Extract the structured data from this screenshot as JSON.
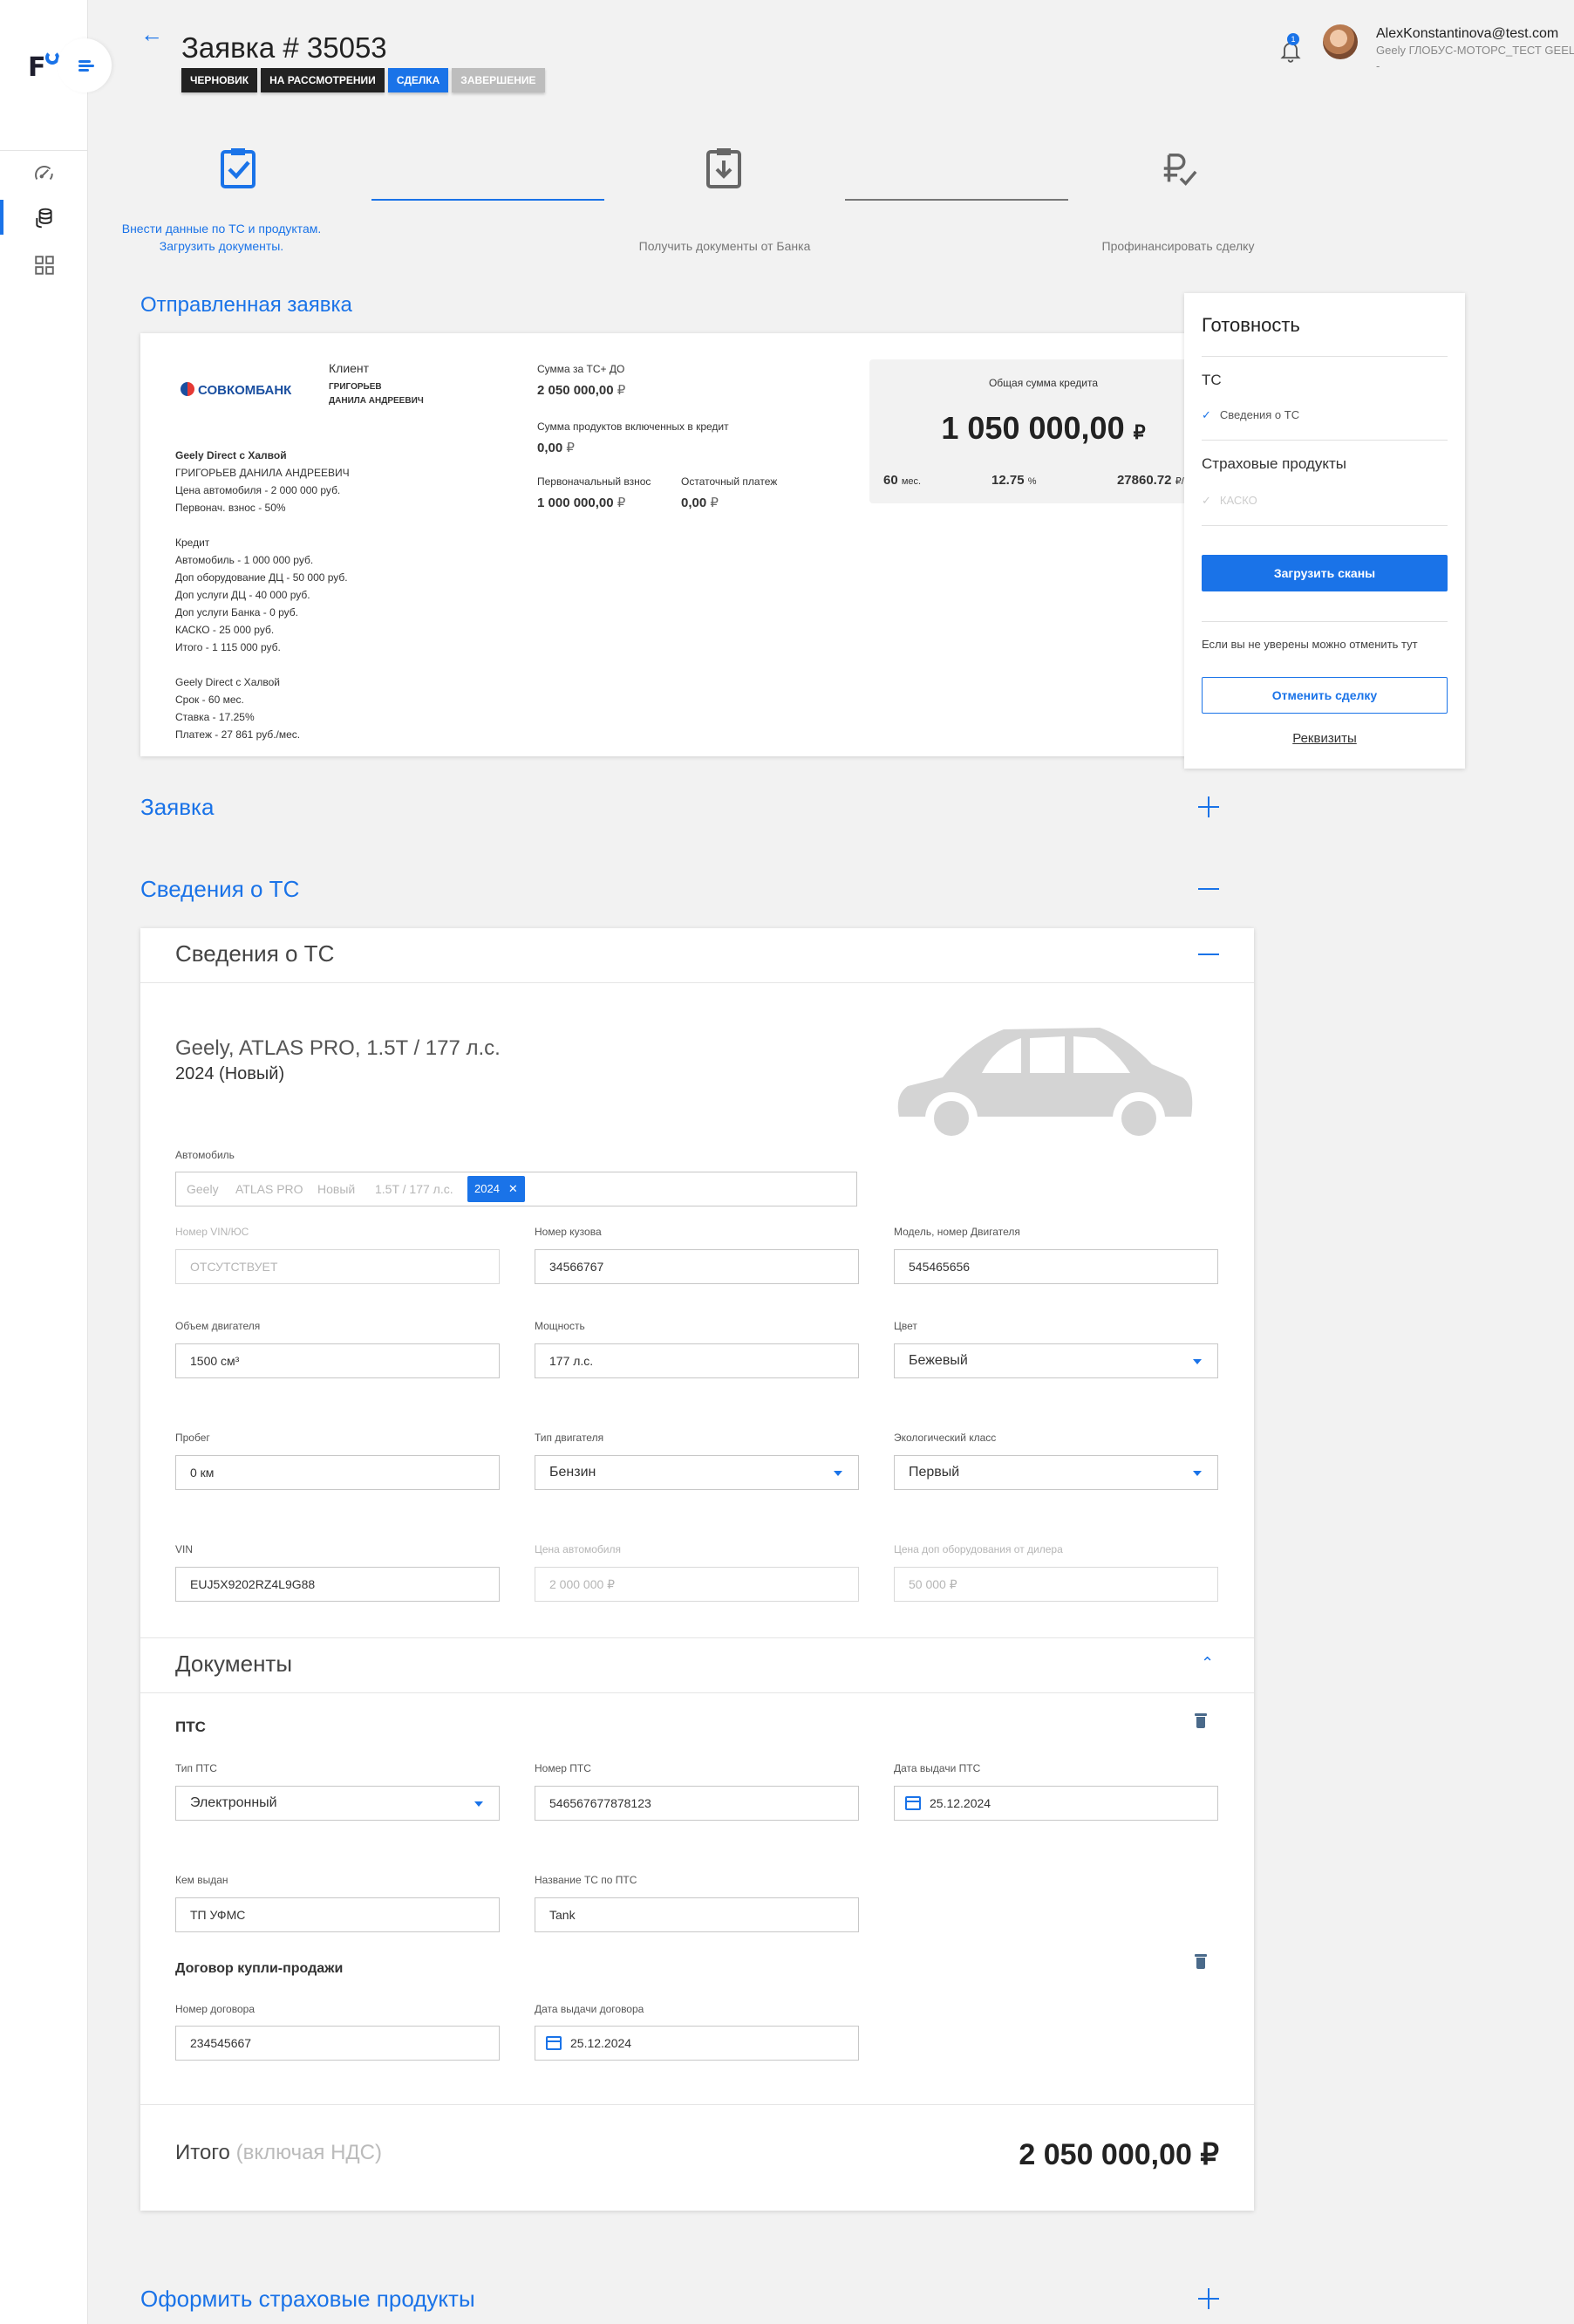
{
  "app": {
    "logo": "F"
  },
  "header": {
    "back": "←",
    "title": "Заявка # 35053",
    "statuses": [
      {
        "label": "Черновик",
        "style": "dark"
      },
      {
        "label": "На рассмотрении",
        "style": "dark"
      },
      {
        "label": "Сделка",
        "style": "blue"
      },
      {
        "label": "Завершение",
        "style": "grey"
      }
    ],
    "notifications_count": "1",
    "user_email": "AlexKonstantinova@test.com",
    "user_org": "Geely ГЛОБУС-МОТОРС_ТЕСТ GEELY",
    "user_extra": "-"
  },
  "steps": [
    {
      "label_line1": "Внести данные по ТС и продуктам.",
      "label_line2": "Загрузить документы.",
      "icon": "clipboard-check-icon",
      "state": "active"
    },
    {
      "label_line1": "Получить документы от Банка",
      "icon": "clipboard-download-icon",
      "state": "inactive"
    },
    {
      "label_line1": "Профинансировать сделку",
      "icon": "ruble-check-icon",
      "state": "inactive"
    }
  ],
  "sent_app": {
    "section_title": "Отправленная заявка",
    "bank_name": "СОВКОМБАНК",
    "client_label": "Клиент",
    "client_name_1": "ГРИГОРЬЕВ",
    "client_name_2": "ДАНИЛА АНДРЕЕВИЧ",
    "details": [
      {
        "text": "Geely Direct с Халвой",
        "bold": true
      },
      {
        "text": "ГРИГОРЬЕВ ДАНИЛА АНДРЕЕВИЧ"
      },
      {
        "text": "Цена автомобиля - 2 000 000 руб."
      },
      {
        "text": "Первонач. взнос - 50%"
      },
      {
        "text": ""
      },
      {
        "text": "Кредит"
      },
      {
        "text": "Автомобиль - 1 000 000 руб."
      },
      {
        "text": "Доп оборудование ДЦ - 50 000 руб."
      },
      {
        "text": "Доп услуги ДЦ - 40 000 руб."
      },
      {
        "text": "Доп услуги Банка - 0 руб."
      },
      {
        "text": "КАСКО - 25 000 руб."
      },
      {
        "text": "Итого - 1 115 000 руб."
      },
      {
        "text": ""
      },
      {
        "text": "Geely Direct с Халвой"
      },
      {
        "text": "Срок - 60 мес."
      },
      {
        "text": "Ставка - 17.25%"
      },
      {
        "text": "Платеж - 27 861 руб./мес."
      }
    ],
    "sum_ts_label": "Сумма за ТС+ ДО",
    "sum_ts_value": "2 050 000,00",
    "sum_products_label": "Сумма продуктов включенных в кредит",
    "sum_products_value": "0,00",
    "down_payment_label": "Первоначальный взнос",
    "down_payment_value": "1 000 000,00",
    "residual_label": "Остаточный платеж",
    "residual_value": "0,00",
    "currency": "₽",
    "credit_total_label": "Общая сумма кредита",
    "credit_total_value": "1 050 000,00",
    "term_value": "60",
    "term_unit": "мес.",
    "rate_value": "12.75",
    "rate_unit": "%",
    "payment_value": "27860.72",
    "payment_unit": "₽/мес."
  },
  "ready": {
    "title": "Готовность",
    "ts_title": "ТС",
    "ts_item": "Сведения о ТС",
    "ins_title": "Страховые продукты",
    "ins_item": "КАСКО",
    "upload_button": "Загрузить сканы",
    "cancel_hint": "Если вы не уверены можно отменить тут",
    "cancel_button": "Отменить сделку",
    "requisites_link": "Реквизиты"
  },
  "sections": {
    "application": "Заявка",
    "vehicle": "Сведения о ТС",
    "insurance": "Оформить страховые продукты"
  },
  "vehicle_card": {
    "title": "Сведения о ТС",
    "car_name": "Geely, ATLAS PRO, 1.5T / 177 л.с.",
    "car_year": "2024 (Новый)",
    "auto_label": "Автомобиль",
    "auto_chips": [
      "Geely",
      "ATLAS PRO",
      "Новый",
      "1.5T / 177 л.с."
    ],
    "auto_selected": "2024",
    "fields": {
      "vin_body_label": "Номер VIN/ЮС",
      "vin_body_value": "ОТСУТСТВУЕТ",
      "body_label": "Номер кузова",
      "body_value": "34566767",
      "engine_model_label": "Модель, номер Двигателя",
      "engine_model_value": "545465656",
      "volume_label": "Объем двигателя",
      "volume_value": "1500 см³",
      "power_label": "Мощность",
      "power_value": "177 л.с.",
      "color_label": "Цвет",
      "color_value": "Бежевый",
      "mileage_label": "Пробег",
      "mileage_value": "0 км",
      "engine_type_label": "Тип двигателя",
      "engine_type_value": "Бензин",
      "eco_label": "Экологический класс",
      "eco_value": "Первый",
      "vin_label": "VIN",
      "vin_value": "EUJ5X9202RZ4L9G88",
      "price_label": "Цена автомобиля",
      "price_value": "2 000 000 ₽",
      "dealer_equip_label": "Цена доп оборудования от дилера",
      "dealer_equip_value": "50 000 ₽"
    },
    "docs_title": "Документы",
    "pts_title": "ПТС",
    "pts_type_label": "Тип ПТС",
    "pts_type_value": "Электронный",
    "pts_number_label": "Номер ПТС",
    "pts_number_value": "546567677878123",
    "pts_date_label": "Дата выдачи ПТС",
    "pts_date_value": "25.12.2024",
    "issued_by_label": "Кем выдан",
    "issued_by_value": "ТП УФМС",
    "ts_name_label": "Название ТС по ПТС",
    "ts_name_value": "Tank",
    "contract_title": "Договор купли-продажи",
    "contract_number_label": "Номер договора",
    "contract_number_value": "234545667",
    "contract_date_label": "Дата выдачи договора",
    "contract_date_value": "25.12.2024",
    "total_label": "Итого",
    "total_note": "(включая НДС)",
    "total_value": "2 050 000,00 ₽"
  },
  "colors": {
    "accent": "#1a73e8",
    "dark_badge": "#222222",
    "grey_badge": "#bdbdbd",
    "background": "#f2f2f2"
  }
}
